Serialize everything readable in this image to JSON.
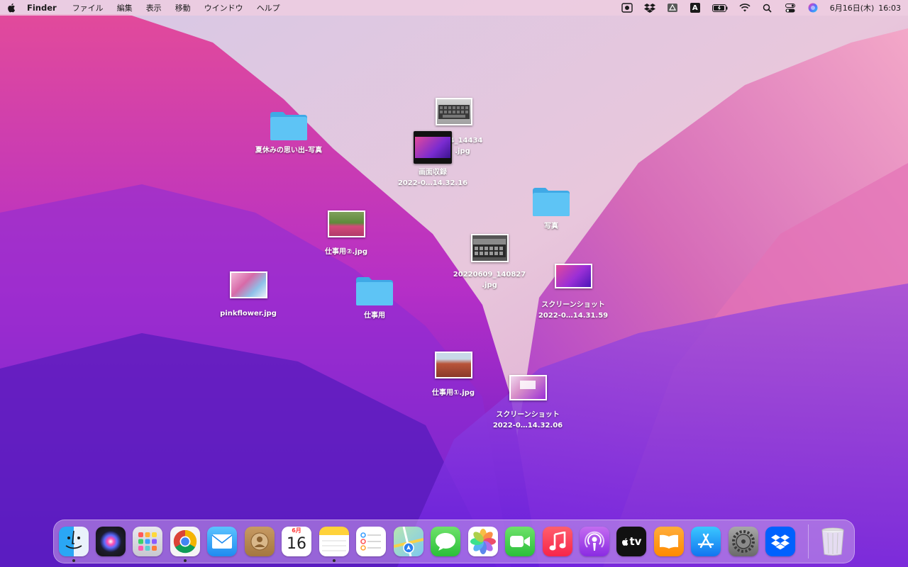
{
  "menubar": {
    "app_name": "Finder",
    "menus": [
      "ファイル",
      "編集",
      "表示",
      "移動",
      "ウインドウ",
      "ヘルプ"
    ],
    "input_mode": "A",
    "date": "6月16日(木)",
    "time": "16:03"
  },
  "desktop": {
    "items": [
      {
        "label": "夏休みの思い出-写真",
        "kind": "folder"
      },
      {
        "label_line1": "…4_14434",
        "label_line2": ".jpg",
        "kind": "image"
      },
      {
        "label_line1": "画面収録",
        "label_line2": "2022-0…14.32.16",
        "kind": "video"
      },
      {
        "label": "写真",
        "kind": "folder"
      },
      {
        "label": "仕事用②.jpg",
        "kind": "image"
      },
      {
        "label_line1": "20220609_140827",
        "label_line2": ".jpg",
        "kind": "image"
      },
      {
        "label_line1": "スクリーンショット",
        "label_line2": "2022-0…14.31.59",
        "kind": "image"
      },
      {
        "label": "pinkflower.jpg",
        "kind": "image"
      },
      {
        "label": "仕事用",
        "kind": "folder"
      },
      {
        "label": "仕事用①.jpg",
        "kind": "image"
      },
      {
        "label_line1": "スクリーンショット",
        "label_line2": "2022-0…14.32.06",
        "kind": "image"
      }
    ]
  },
  "dock": {
    "calendar_month": "6月",
    "calendar_day": "16",
    "tv_label": "tv",
    "apps": [
      "finder",
      "siri",
      "launchpad",
      "chrome",
      "mail",
      "contacts",
      "calendar",
      "notes",
      "reminders",
      "maps",
      "messages",
      "photos",
      "facetime",
      "music",
      "podcasts",
      "apple-tv",
      "books",
      "app-store",
      "system-preferences",
      "dropbox",
      "trash"
    ]
  },
  "colors": {
    "folder": "#5ec4f5",
    "menubar": "#eecde1",
    "dock": "#c8a0eb"
  }
}
